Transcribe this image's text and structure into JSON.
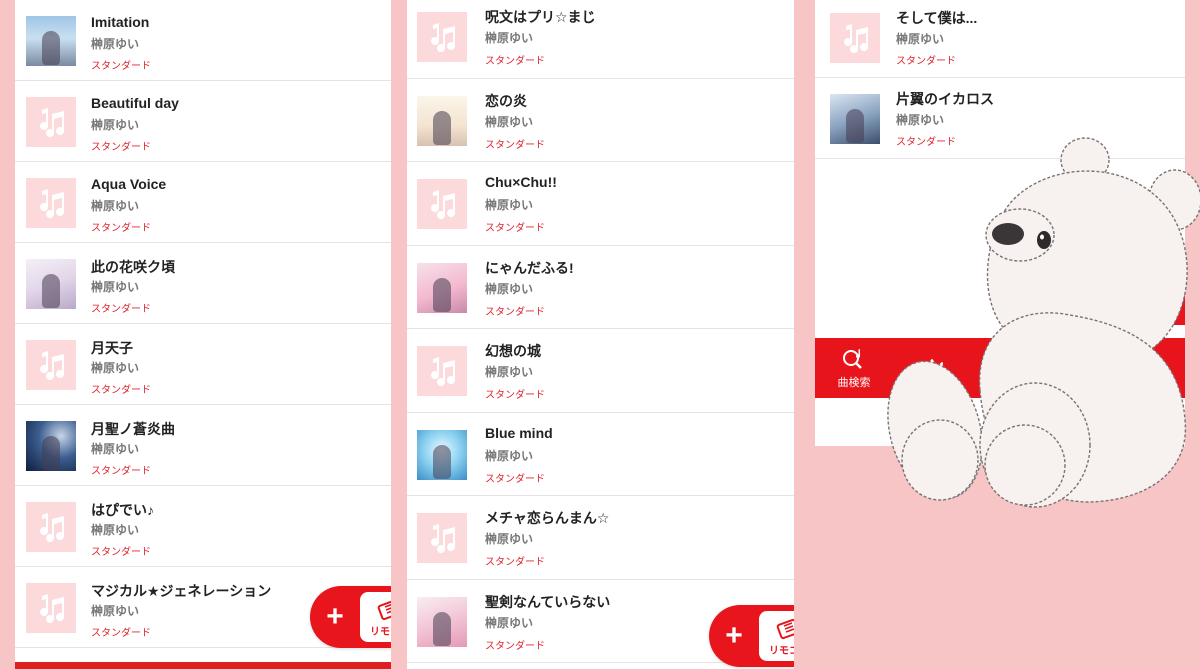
{
  "colors": {
    "brand_red": "#e8151c",
    "tag_red": "#e0252f",
    "background_pink": "#f7c5c6",
    "placeholder_pink": "#fcd9db"
  },
  "icons": {
    "placeholder": "music-note-icon",
    "fab_add": "plus-icon",
    "fab_remote": "remote-control-icon",
    "nav_search": "search-note-icon",
    "nav_ranking": "crown-icon"
  },
  "panel1": {
    "songs": [
      {
        "title": "Imitation",
        "artist": "榊原ゆい",
        "tag": "スタンダード"
      },
      {
        "title": "Beautiful day",
        "artist": "榊原ゆい",
        "tag": "スタンダード"
      },
      {
        "title": "Aqua Voice",
        "artist": "榊原ゆい",
        "tag": "スタンダード"
      },
      {
        "title": "此の花咲ク頃",
        "artist": "榊原ゆい",
        "tag": "スタンダード"
      },
      {
        "title": "月天子",
        "artist": "榊原ゆい",
        "tag": "スタンダード"
      },
      {
        "title": "月聖ノ蒼炎曲",
        "artist": "榊原ゆい",
        "tag": "スタンダード"
      },
      {
        "title": "はぴでい♪",
        "artist": "榊原ゆい",
        "tag": "スタンダード"
      },
      {
        "title": "マジカル★ジェネレーション",
        "artist": "榊原ゆい",
        "tag": "スタンダード"
      }
    ]
  },
  "panel2": {
    "songs": [
      {
        "title": "呪文はプリ☆まじ",
        "artist": "榊原ゆい",
        "tag": "スタンダード"
      },
      {
        "title": "恋の炎",
        "artist": "榊原ゆい",
        "tag": "スタンダード"
      },
      {
        "title": "Chu×Chu!!",
        "artist": "榊原ゆい",
        "tag": "スタンダード"
      },
      {
        "title": "にゃんだふる!",
        "artist": "榊原ゆい",
        "tag": "スタンダード"
      },
      {
        "title": "幻想の城",
        "artist": "榊原ゆい",
        "tag": "スタンダード"
      },
      {
        "title": "Blue mind",
        "artist": "榊原ゆい",
        "tag": "スタンダード"
      },
      {
        "title": "メチャ恋らんまん☆",
        "artist": "榊原ゆい",
        "tag": "スタンダード"
      },
      {
        "title": "聖剣なんていらない",
        "artist": "榊原ゆい",
        "tag": "スタンダード"
      }
    ]
  },
  "panel3": {
    "songs": [
      {
        "title": "そして僕は...",
        "artist": "榊原ゆい",
        "tag": "スタンダード"
      },
      {
        "title": "片翼のイカロス",
        "artist": "榊原ゆい",
        "tag": "スタンダード"
      }
    ],
    "nav": {
      "search_label": "曲検索"
    }
  },
  "fab": {
    "add_symbol": "+",
    "remote_label": "リモコン"
  }
}
